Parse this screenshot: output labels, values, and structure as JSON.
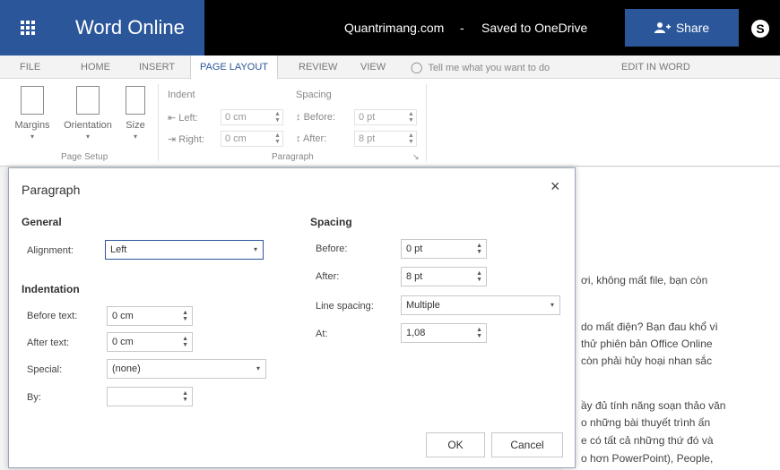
{
  "titlebar": {
    "app_name": "Word Online",
    "doc_title": "Quantrimang.com",
    "separator": "-",
    "status": "Saved to OneDrive",
    "share_label": "Share"
  },
  "tabs": [
    {
      "label": "FILE"
    },
    {
      "label": "HOME"
    },
    {
      "label": "INSERT"
    },
    {
      "label": "PAGE LAYOUT"
    },
    {
      "label": "REVIEW"
    },
    {
      "label": "VIEW"
    },
    {
      "label": "EDIT IN WORD"
    }
  ],
  "tell_me": "Tell me what you want to do",
  "ribbon": {
    "margins": "Margins",
    "orientation": "Orientation",
    "size": "Size",
    "page_setup": "Page Setup",
    "indent": "Indent",
    "left_label": "Left:",
    "left_value": "0 cm",
    "right_label": "Right:",
    "right_value": "0 cm",
    "spacing": "Spacing",
    "before_label": "Before:",
    "before_value": "0 pt",
    "after_label": "After:",
    "after_value": "8 pt",
    "paragraph": "Paragraph"
  },
  "doc_lines": [
    "ơi, không mất file, bạn còn",
    "do mất điện? Bạn đau khổ vì",
    "thử phiên bản Office Online",
    "còn phải hủy hoại nhan sắc",
    "ầy đủ tính năng soạn thảo văn",
    "o những bài thuyết trình ấn",
    "e có tất cả những thứ đó và",
    "o hơn PowerPoint), People,"
  ],
  "dialog": {
    "title": "Paragraph",
    "close": "×",
    "general": "General",
    "alignment_label": "Alignment:",
    "alignment_value": "Left",
    "indentation": "Indentation",
    "before_text_label": "Before text:",
    "before_text_value": "0 cm",
    "after_text_label": "After text:",
    "after_text_value": "0 cm",
    "special_label": "Special:",
    "special_value": "(none)",
    "by_label": "By:",
    "by_value": "",
    "spacing": "Spacing",
    "before_label": "Before:",
    "before_value": "0 pt",
    "after_label": "After:",
    "after_value": "8 pt",
    "line_spacing_label": "Line spacing:",
    "line_spacing_value": "Multiple",
    "at_label": "At:",
    "at_value": "1,08",
    "ok": "OK",
    "cancel": "Cancel"
  },
  "colors": {
    "accent": "#2b579a",
    "titlebar": "#000000"
  }
}
